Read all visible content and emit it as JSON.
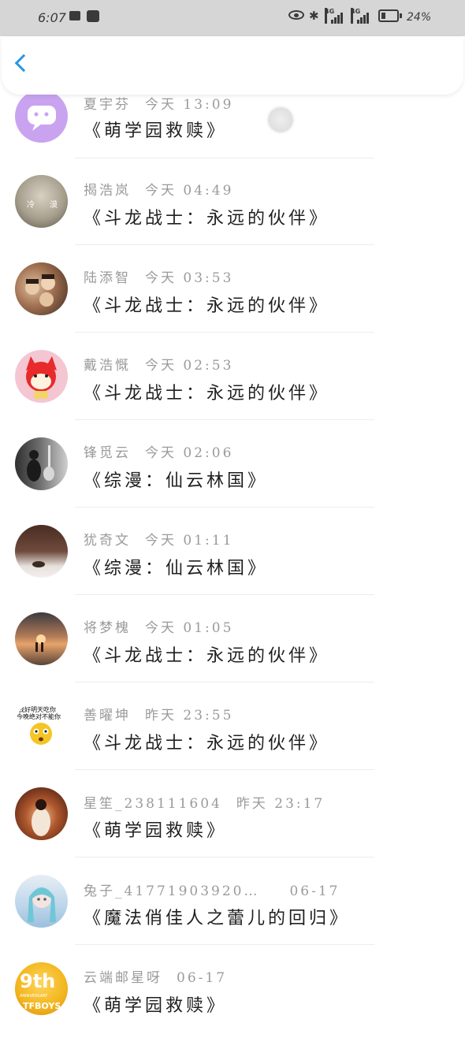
{
  "status_bar": {
    "time": "6:07",
    "network_1": "4G",
    "network_2": "4G",
    "battery": "24%"
  },
  "header": {
    "back_icon": "chevron-left-icon",
    "accent": "#2a96e6"
  },
  "items": [
    {
      "name": "夏宇芬",
      "time": "今天 13:09",
      "title": "《萌学园救赎》",
      "avatar_color": "#c9a3f0"
    },
    {
      "name": "揭浩岚",
      "time": "今天 04:49",
      "title": "《斗龙战士：永远的伙伴》",
      "avatar_color": "#7b7b70"
    },
    {
      "name": "陆添智",
      "time": "今天 03:53",
      "title": "《斗龙战士：永远的伙伴》",
      "avatar_color": "#8e6a4e"
    },
    {
      "name": "戴浩慨",
      "time": "今天 02:53",
      "title": "《斗龙战士：永远的伙伴》",
      "avatar_color": "#f07f9a"
    },
    {
      "name": "锋觅云",
      "time": "今天 02:06",
      "title": "《综漫：仙云林国》",
      "avatar_color": "#5c5c5c"
    },
    {
      "name": "犹奇文",
      "time": "今天 01:11",
      "title": "《综漫：仙云林国》",
      "avatar_color": "#5e3f35"
    },
    {
      "name": "将梦槐",
      "time": "今天 01:05",
      "title": "《斗龙战士：永远的伙伴》",
      "avatar_color": "#b87a55"
    },
    {
      "name": "善曜坤",
      "time": "昨天 23:55",
      "title": "《斗龙战士：永远的伙伴》",
      "avatar_color": "#ffffff"
    },
    {
      "name": "星笙_238111604",
      "time": "昨天 23:17",
      "title": "《萌学园救赎》",
      "avatar_color": "#6b2a1e"
    },
    {
      "name": "兔子_41771903920…",
      "time": "06-17",
      "title": "《魔法俏佳人之蕾儿的回归》",
      "avatar_color": "#bcd5ea"
    },
    {
      "name": "云端邮星呀",
      "time": "06-17",
      "title": "《萌学园救赎》",
      "avatar_color": "#f2b51c"
    }
  ],
  "avatar_labels": {
    "item_2_left": "冷",
    "item_2_right": "漠",
    "item_8_line1": "我好明天吃你",
    "item_8_line2": "今晚绝对不能你",
    "item_11": "9th",
    "item_11_sub": "ANNIVERSARY",
    "item_11_brand": "TFBOYS"
  }
}
